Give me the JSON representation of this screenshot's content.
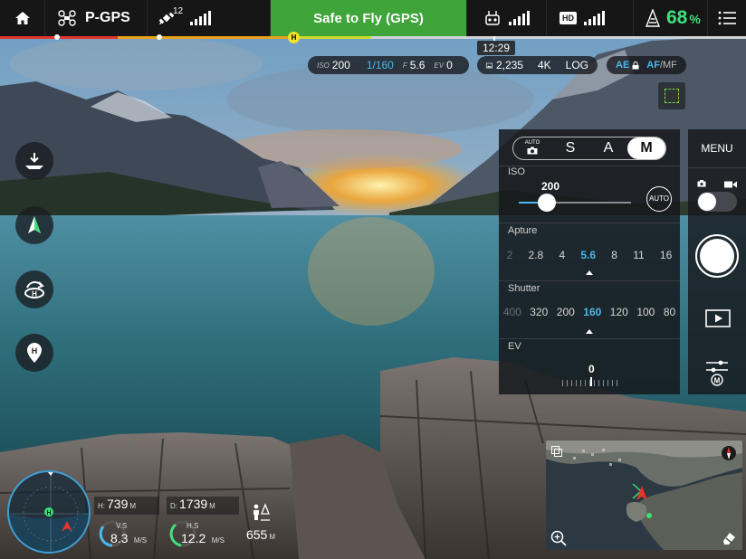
{
  "topbar": {
    "flight_mode": "P-GPS",
    "gps_satellites": "12",
    "status": "Safe to Fly (GPS)",
    "hd_label": "HD",
    "battery_percent": "68",
    "battery_unit": "%"
  },
  "flight_line": {
    "home_marker": "H",
    "time_remaining": "12:29"
  },
  "camera_params": {
    "iso_label": "ISO",
    "iso_value": "200",
    "shutter_value": "1/160",
    "f_label": "F",
    "f_value": "5.6",
    "ev_label": "EV",
    "ev_value": "0",
    "photos_remaining": "2,235",
    "resolution": "4K",
    "color_profile": "LOG",
    "ae_label": "AE",
    "af_label": "AF",
    "mf_label": "MF"
  },
  "camera_panel": {
    "modes": [
      "AUTO",
      "S",
      "A",
      "M"
    ],
    "selected_mode": "M",
    "iso_section": "ISO",
    "iso_value": "200",
    "iso_auto": "AUTO",
    "iso_slider_fraction": 0.25,
    "aperture_section": "Apture",
    "aperture_values": [
      "2",
      "2.8",
      "4",
      "5.6",
      "8",
      "11",
      "16"
    ],
    "aperture_selected": "5.6",
    "shutter_section": "Shutter",
    "shutter_values": [
      "400",
      "320",
      "200",
      "160",
      "120",
      "100",
      "80"
    ],
    "shutter_selected": "160",
    "ev_section": "EV",
    "ev_value": "0"
  },
  "right_column": {
    "menu_label": "MENU"
  },
  "telemetry": {
    "height_label": "H:",
    "height_value": "739",
    "height_unit": "M",
    "distance_label": "D:",
    "distance_value": "1739",
    "distance_unit": "M",
    "vs_label": "V.S",
    "vs_value": "8.3",
    "vs_unit": "M/S",
    "hs_label": "H.S",
    "hs_value": "12.2",
    "hs_unit": "M/S",
    "altitude_value": "655",
    "altitude_unit": "M",
    "radar_home": "H"
  },
  "colors": {
    "safe_green": "#3fa53a",
    "battery_green": "#3fe07a",
    "accent_blue": "#4ab8f0",
    "focus_green": "#7bd44a"
  },
  "icons": {
    "home": "home-icon",
    "aircraft": "drone-icon",
    "satellite": "satellite-icon",
    "remote": "remote-controller-icon",
    "battery": "battery-icon",
    "menu": "list-menu-icon"
  }
}
